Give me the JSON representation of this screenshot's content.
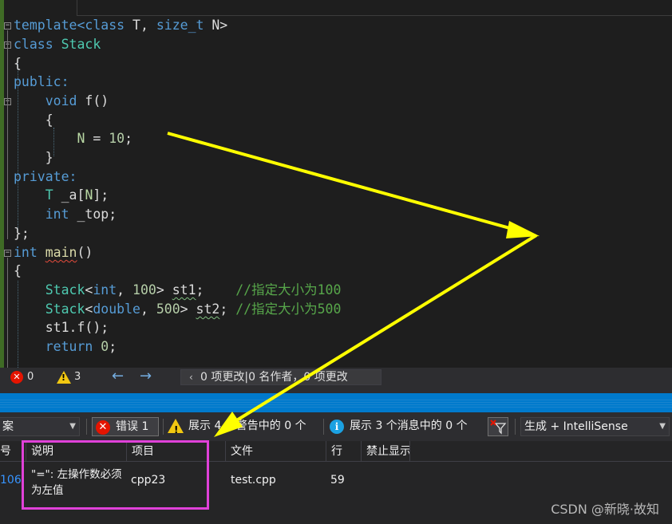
{
  "editor": {
    "lines": {
      "l1": {
        "a": "template<",
        "b": "class",
        "c": " T, ",
        "d": "size_t",
        "e": " N>"
      },
      "l2": {
        "a": "class",
        "b": " Stack"
      },
      "l3": "{",
      "l4": "public:",
      "l5": {
        "a": "void",
        "b": " f()"
      },
      "l6": "{",
      "l7": {
        "a": "N",
        "b": " = ",
        "c": "10",
        "d": ";"
      },
      "l8": "}",
      "l9": "private:",
      "l10": {
        "a": "T",
        "b": " _a[",
        "c": "N",
        "d": "];"
      },
      "l11": {
        "a": "int",
        "b": " _top;"
      },
      "l12": "};",
      "l13": {
        "a": "int",
        "b": " ",
        "c": "main",
        "d": "()"
      },
      "l14": "{",
      "l15": {
        "a": "Stack",
        "b": "<",
        "c": "int",
        "d": ", ",
        "e": "100",
        "f": "> ",
        "g": "st1",
        "h": ";    ",
        "i": "//指定大小为100"
      },
      "l16": {
        "a": "Stack",
        "b": "<",
        "c": "double",
        "d": ", ",
        "e": "500",
        "f": "> ",
        "g": "st2",
        "h": "; ",
        "i": "//指定大小为500"
      },
      "l17": {
        "a": "st1.f();"
      },
      "l18": {
        "a": "return",
        "b": " ",
        "c": "0",
        "d": ";"
      }
    }
  },
  "status_strip": {
    "errors": "0",
    "warnings": "3",
    "codelens": "0 项更改|0 名作者，0 项更改"
  },
  "error_list": {
    "scope_value": "案",
    "errors_toggle": "错误 1",
    "warnings_toggle": "展示 4 个警告中的 0 个",
    "messages_toggle": "展示 3 个消息中的 0 个",
    "build_filter": "生成 + IntelliSense",
    "columns": [
      "号",
      "说明",
      "项目",
      "文件",
      "行",
      "禁止显示"
    ],
    "rows": [
      {
        "code": "106",
        "description": "\"=\": 左操作数必须为左值",
        "project": "cpp23",
        "file": "test.cpp",
        "line": "59"
      }
    ]
  },
  "watermark": "CSDN @新晓·故知",
  "colors": {
    "highlight_box": "#e041d8",
    "arrow": "#ffff00",
    "accent": "#007acc"
  }
}
